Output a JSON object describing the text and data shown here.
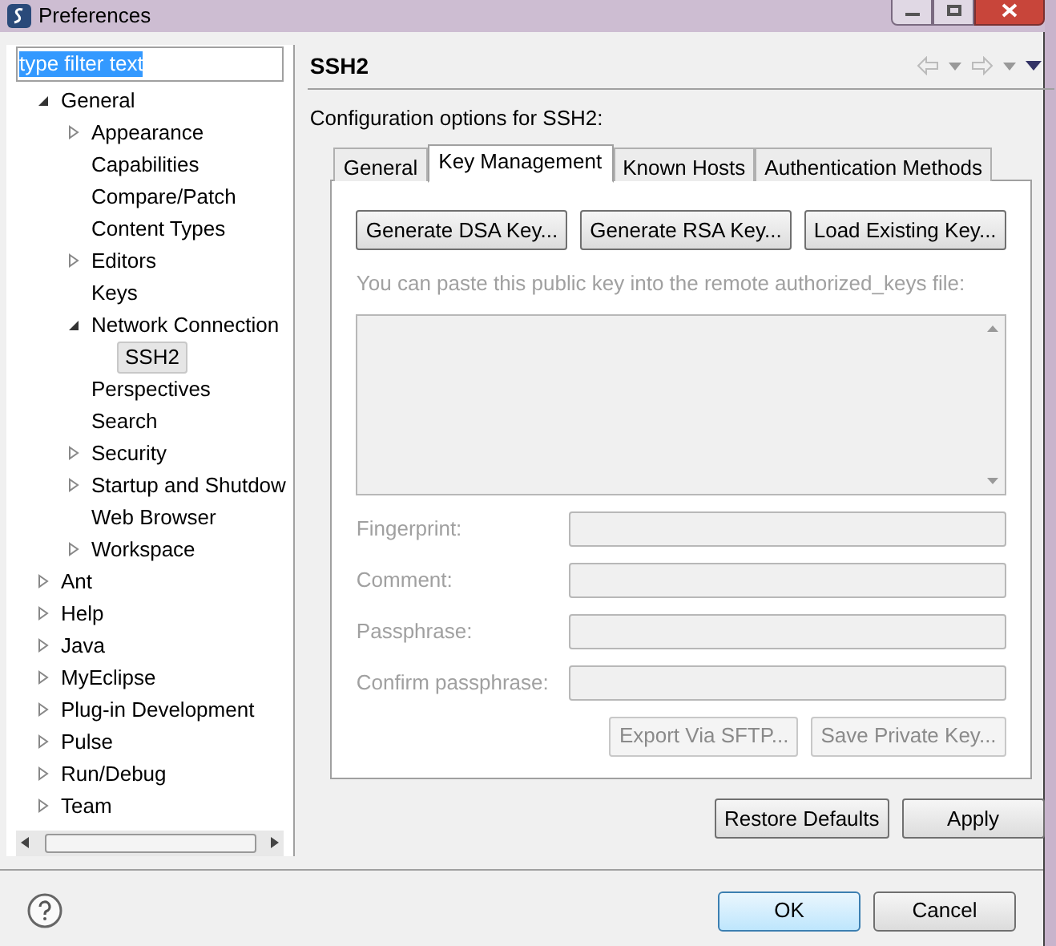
{
  "window": {
    "title": "Preferences"
  },
  "filter": {
    "value": "type filter text"
  },
  "tree": [
    {
      "label": "General",
      "kind": "branch",
      "expanded": true,
      "selected": false,
      "children": [
        {
          "label": "Appearance",
          "kind": "branch",
          "expanded": false,
          "selected": false
        },
        {
          "label": "Capabilities",
          "kind": "leaf",
          "selected": false
        },
        {
          "label": "Compare/Patch",
          "kind": "leaf",
          "selected": false
        },
        {
          "label": "Content Types",
          "kind": "leaf",
          "selected": false
        },
        {
          "label": "Editors",
          "kind": "branch",
          "expanded": false,
          "selected": false
        },
        {
          "label": "Keys",
          "kind": "leaf",
          "selected": false
        },
        {
          "label": "Network Connection",
          "kind": "branch",
          "expanded": true,
          "selected": false,
          "children": [
            {
              "label": "SSH2",
              "kind": "leaf",
              "selected": true
            }
          ]
        },
        {
          "label": "Perspectives",
          "kind": "leaf",
          "selected": false
        },
        {
          "label": "Search",
          "kind": "leaf",
          "selected": false
        },
        {
          "label": "Security",
          "kind": "branch",
          "expanded": false,
          "selected": false
        },
        {
          "label": "Startup and Shutdow",
          "kind": "branch",
          "expanded": false,
          "selected": false
        },
        {
          "label": "Web Browser",
          "kind": "leaf",
          "selected": false
        },
        {
          "label": "Workspace",
          "kind": "branch",
          "expanded": false,
          "selected": false
        }
      ]
    },
    {
      "label": "Ant",
      "kind": "branch",
      "expanded": false,
      "selected": false
    },
    {
      "label": "Help",
      "kind": "branch",
      "expanded": false,
      "selected": false
    },
    {
      "label": "Java",
      "kind": "branch",
      "expanded": false,
      "selected": false
    },
    {
      "label": "MyEclipse",
      "kind": "branch",
      "expanded": false,
      "selected": false
    },
    {
      "label": "Plug-in Development",
      "kind": "branch",
      "expanded": false,
      "selected": false
    },
    {
      "label": "Pulse",
      "kind": "branch",
      "expanded": false,
      "selected": false
    },
    {
      "label": "Run/Debug",
      "kind": "branch",
      "expanded": false,
      "selected": false
    },
    {
      "label": "Team",
      "kind": "branch",
      "expanded": false,
      "selected": false
    }
  ],
  "page": {
    "title": "SSH2",
    "description": "Configuration options for SSH2:"
  },
  "tabs": [
    {
      "label": "General",
      "selected": false
    },
    {
      "label": "Key Management",
      "selected": true
    },
    {
      "label": "Known Hosts",
      "selected": false
    },
    {
      "label": "Authentication Methods",
      "selected": false
    }
  ],
  "key_buttons": [
    {
      "label": "Generate DSA Key...",
      "disabled": false
    },
    {
      "label": "Generate RSA Key...",
      "disabled": false
    },
    {
      "label": "Load Existing Key...",
      "disabled": false
    }
  ],
  "public_key_label": {
    "text": "You can paste this public key into the remote authorized_keys file:",
    "disabled": true
  },
  "fields": [
    {
      "label": "Fingerprint:",
      "disabled": true
    },
    {
      "label": "Comment:",
      "disabled": true
    },
    {
      "label": "Passphrase:",
      "disabled": true
    },
    {
      "label": "Confirm passphrase:",
      "disabled": true
    }
  ],
  "export_buttons": [
    {
      "label": "Export Via SFTP...",
      "disabled": true
    },
    {
      "label": "Save Private Key...",
      "disabled": true
    }
  ],
  "page_buttons": [
    "Restore Defaults",
    "Apply"
  ],
  "dialog_buttons": [
    {
      "label": "OK",
      "default": true
    },
    {
      "label": "Cancel",
      "default": false
    }
  ]
}
